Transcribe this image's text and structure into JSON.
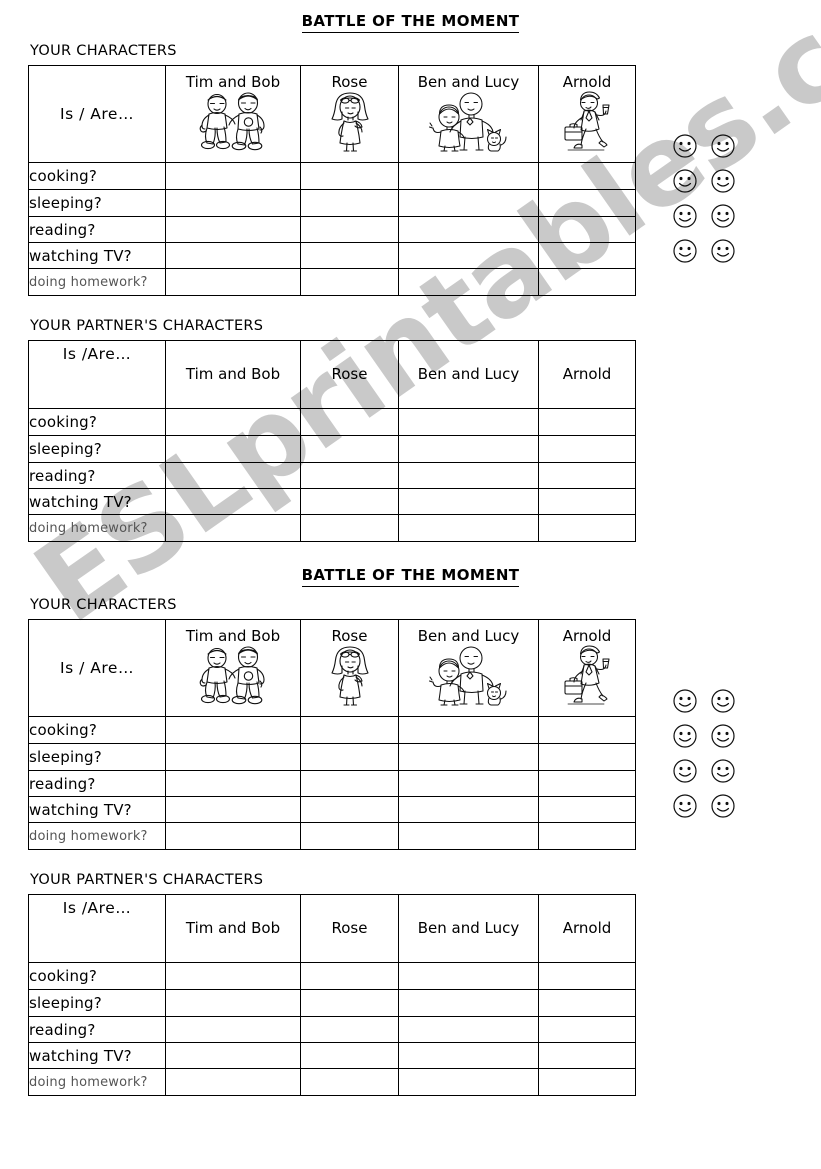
{
  "worksheet": {
    "title": "BATTLE OF THE MOMENT",
    "watermark": "ESLprintables.com"
  },
  "labels": {
    "your_characters": "YOUR CHARACTERS",
    "partner_characters": "YOUR PARTNER'S CHARACTERS",
    "is_are_spaced": "Is / Are…",
    "is_are_tight": "Is /Are…"
  },
  "characters": [
    {
      "name": "Tim and Bob",
      "art": "two-boys-sitting-icon"
    },
    {
      "name": "Rose",
      "art": "girl-standing-icon"
    },
    {
      "name": "Ben and Lucy",
      "art": "boy-girl-with-pet-icon"
    },
    {
      "name": "Arnold",
      "art": "businessman-walking-icon"
    }
  ],
  "activities": [
    {
      "text": "cooking?",
      "style": "normal"
    },
    {
      "text": "sleeping?",
      "style": "normal"
    },
    {
      "text": "reading?",
      "style": "normal"
    },
    {
      "text": "watching TV?",
      "style": "normal"
    },
    {
      "text": "doing homework?",
      "style": "small"
    }
  ],
  "smiley_panel": {
    "icon": "smiley-face-icon",
    "rows": 4,
    "columns": 2,
    "count": 8
  },
  "colors": {
    "ink": "#000000",
    "watermark": "#c9c9c9",
    "faint_text": "#555555"
  }
}
